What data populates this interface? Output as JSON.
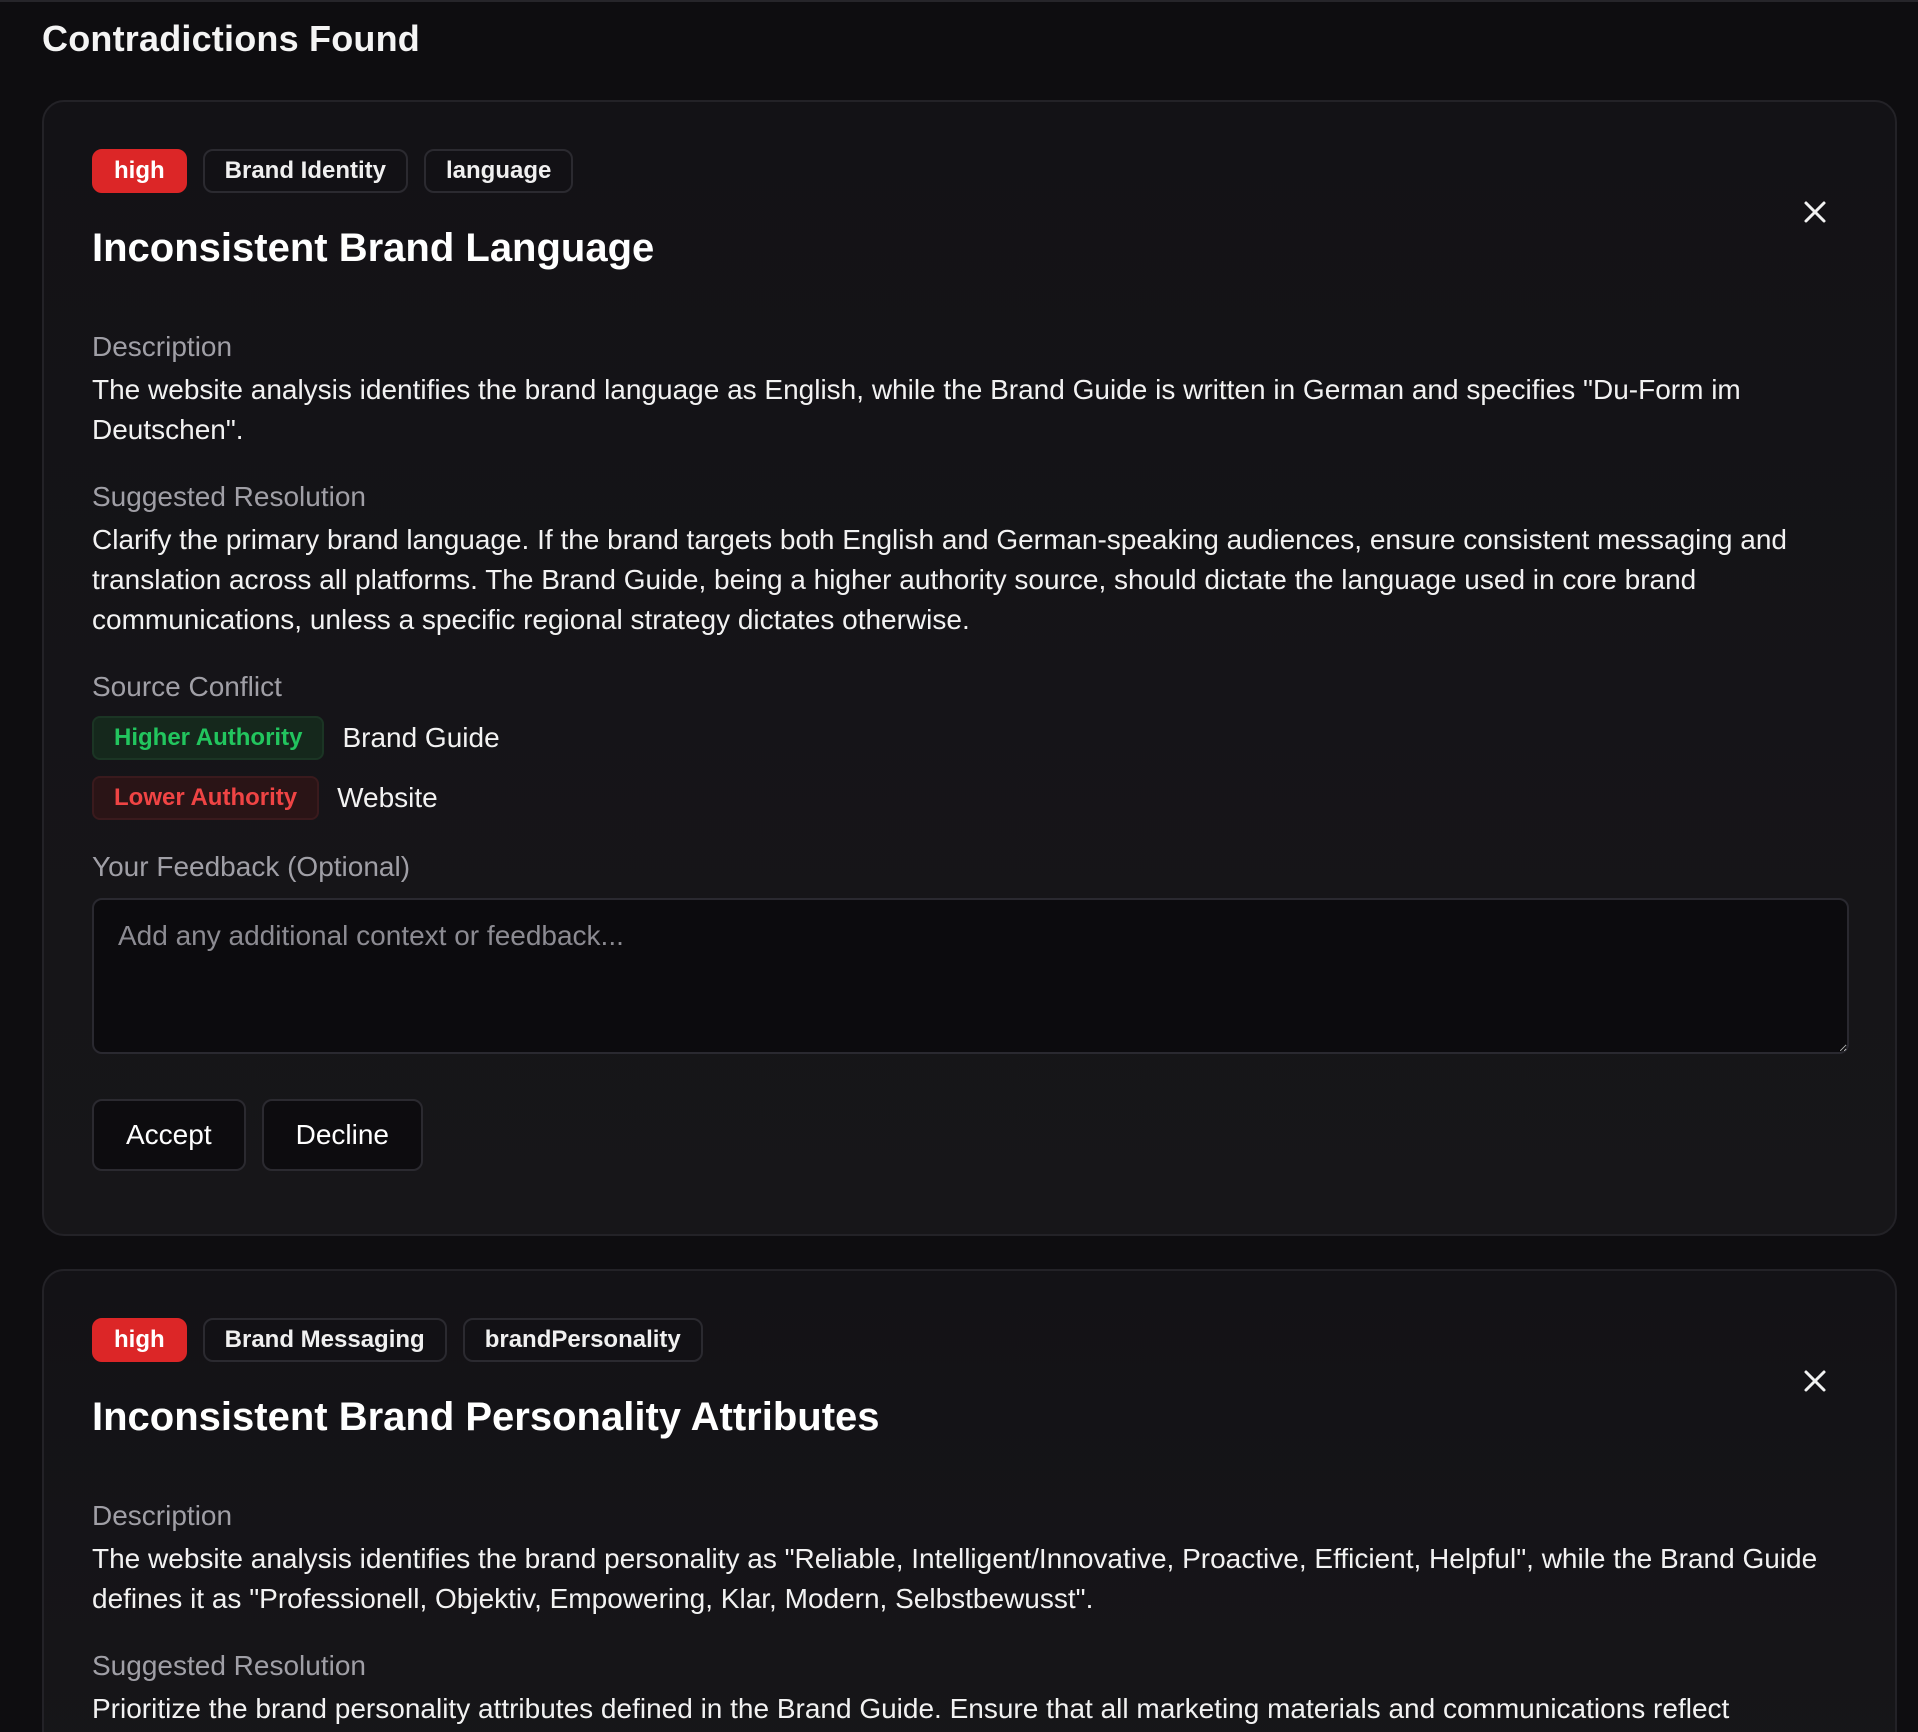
{
  "page": {
    "heading": "Contradictions Found"
  },
  "cards": [
    {
      "severity": "high",
      "category": "Brand Identity",
      "field": "language",
      "title": "Inconsistent Brand Language",
      "description_label": "Description",
      "description": "The website analysis identifies the brand language as English, while the Brand Guide is written in German and specifies \"Du-Form im Deutschen\".",
      "resolution_label": "Suggested Resolution",
      "resolution": "Clarify the primary brand language. If the brand targets both English and German-speaking audiences, ensure consistent messaging and translation across all platforms. The Brand Guide, being a higher authority source, should dictate the language used in core brand communications, unless a specific regional strategy dictates otherwise.",
      "source_label": "Source Conflict",
      "higher_label": "Higher Authority",
      "higher_source": "Brand Guide",
      "lower_label": "Lower Authority",
      "lower_source": "Website",
      "feedback_label": "Your Feedback (Optional)",
      "feedback_placeholder": "Add any additional context or feedback...",
      "feedback_value": "",
      "accept_label": "Accept",
      "decline_label": "Decline"
    },
    {
      "severity": "high",
      "category": "Brand Messaging",
      "field": "brandPersonality",
      "title": "Inconsistent Brand Personality Attributes",
      "description_label": "Description",
      "description": "The website analysis identifies the brand personality as \"Reliable, Intelligent/Innovative, Proactive, Efficient, Helpful\", while the Brand Guide defines it as \"Professionell, Objektiv, Empowering, Klar, Modern, Selbstbewusst\".",
      "resolution_label": "Suggested Resolution",
      "resolution": "Prioritize the brand personality attributes defined in the Brand Guide. Ensure that all marketing materials and communications reflect"
    }
  ],
  "colors": {
    "background": "#0e0d10",
    "severity_high": "#dc2627",
    "higher_authority": "#22c55e",
    "lower_authority": "#ef4444"
  },
  "icons": {
    "close": "close-icon"
  }
}
